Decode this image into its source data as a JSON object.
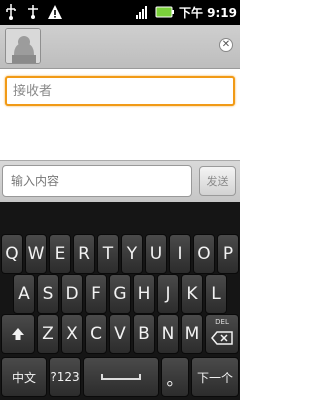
{
  "status_bar": {
    "time_label": "下午 9:19",
    "icons": [
      "usb-icon",
      "usb-debug-icon",
      "warning-icon",
      "signal-icon",
      "battery-icon"
    ]
  },
  "recipient": {
    "placeholder": "接收者"
  },
  "compose": {
    "placeholder": "输入内容",
    "send_label": "发送"
  },
  "keyboard": {
    "row1": [
      "Q",
      "W",
      "E",
      "R",
      "T",
      "Y",
      "U",
      "I",
      "O",
      "P"
    ],
    "row2": [
      "A",
      "S",
      "D",
      "F",
      "G",
      "H",
      "J",
      "K",
      "L"
    ],
    "row3": [
      "Z",
      "X",
      "C",
      "V",
      "B",
      "N",
      "M"
    ],
    "lang_label": "中文",
    "symbols_label": "?123",
    "period_label": "。",
    "next_label": "下一个",
    "delete_label": "DEL"
  },
  "colors": {
    "focus": "#f19a16",
    "keyboard_bg": "#151515",
    "key_bg": "#3a3a3a",
    "header_bg": "#c8c8c8"
  }
}
